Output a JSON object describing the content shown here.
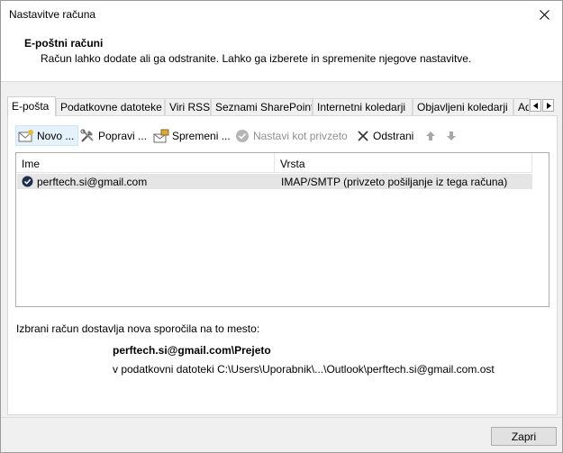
{
  "window": {
    "title": "Nastavitve računa"
  },
  "header": {
    "title": "E-poštni računi",
    "description": "Račun lahko dodate ali ga odstranite. Lahko ga izberete in spremenite njegove nastavitve."
  },
  "tabs": [
    {
      "label": "E-pošta",
      "active": true
    },
    {
      "label": "Podatkovne datoteke"
    },
    {
      "label": "Viri RSS"
    },
    {
      "label": "Seznami SharePoint"
    },
    {
      "label": "Internetni koledarji"
    },
    {
      "label": "Objavljeni koledarji"
    },
    {
      "label": "Ad"
    }
  ],
  "toolbar": {
    "new_label": "Novo ...",
    "repair_label": "Popravi ...",
    "change_label": "Spremeni ...",
    "set_default_label": "Nastavi kot privzeto",
    "remove_label": "Odstrani"
  },
  "accounts": {
    "columns": [
      "Ime",
      "Vrsta"
    ],
    "rows": [
      {
        "name": "perftech.si@gmail.com",
        "type": "IMAP/SMTP (privzeto pošiljanje iz tega računa)"
      }
    ]
  },
  "delivery": {
    "label": "Izbrani račun dostavlja nova sporočila na to mesto:",
    "folder": "perftech.si@gmail.com\\Prejeto",
    "file": "v podatkovni datoteki C:\\Users\\Uporabnik\\...\\Outlook\\perftech.si@gmail.com.ost"
  },
  "footer": {
    "close_label": "Zapri"
  },
  "colors": {
    "selected_row": "#e5e5e5",
    "accent": "#0078d7"
  }
}
